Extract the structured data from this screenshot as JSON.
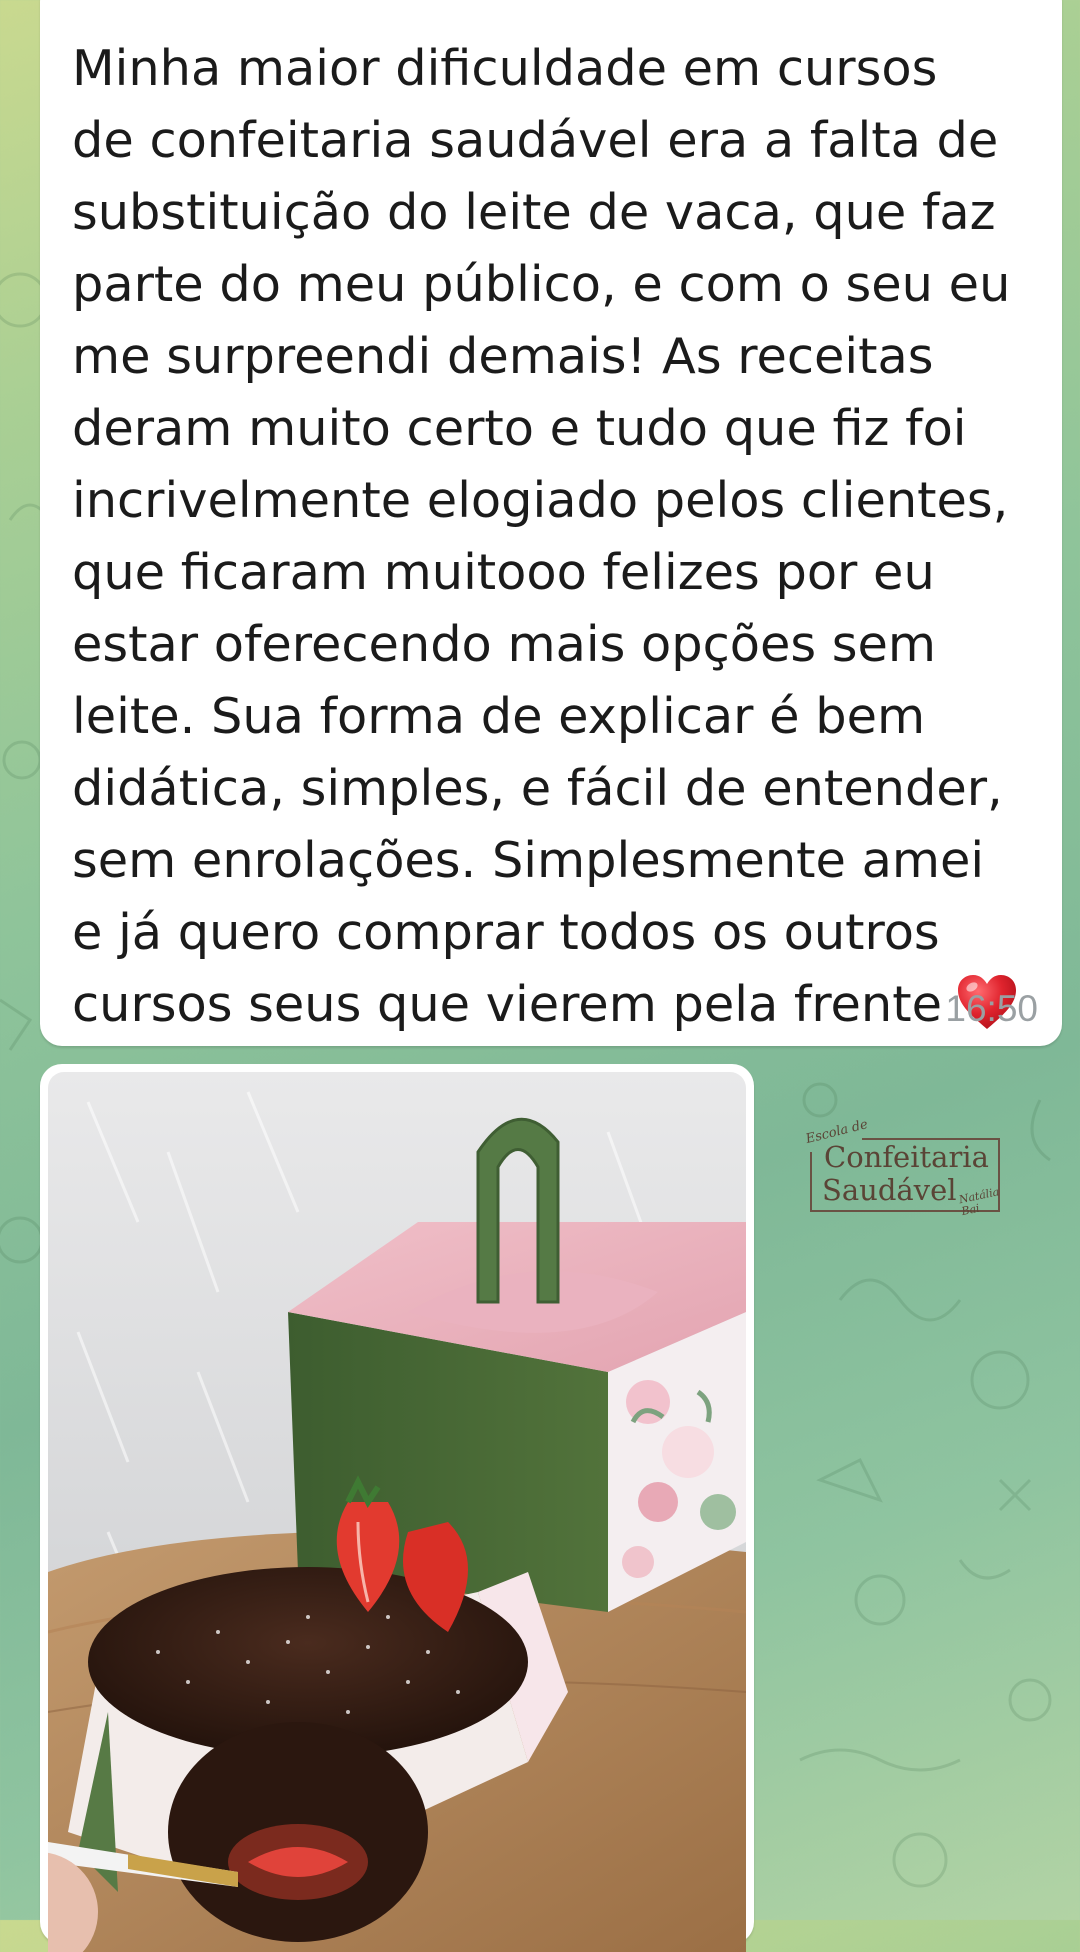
{
  "message": {
    "lines": [
      "Minha maior dificuldade em cursos",
      "de confeitaria saudável era a falta de",
      "substituição do leite de vaca, que faz",
      "parte do meu público, e com o seu eu",
      "me surpreendi demais! As receitas",
      "deram muito certo e tudo que fiz foi",
      "incrivelmente elogiado pelos clientes,",
      "que ficaram muitooo felizes por eu",
      "estar oferecendo mais opções sem",
      "leite. Sua forma de explicar é bem",
      "didática, simples, e fácil de entender,",
      "sem enrolações. Simplesmente amei",
      "e já quero comprar todos os outros",
      "cursos seus que vierem pela frente"
    ],
    "emoji": "heart-emoji",
    "time": "16:50"
  },
  "photo_message": {
    "image": "photo-chocolate-cake-gift-box"
  },
  "logo": {
    "small_text": "Escola de",
    "line1": "Confeitaria",
    "line2": "Saudável",
    "signature": "Natália Bai"
  },
  "colors": {
    "bubble": "#ffffff",
    "text": "#1b1b1b",
    "time": "#9aa0a3",
    "heart": "#e0242e",
    "chat_background": "#8fc49a"
  }
}
